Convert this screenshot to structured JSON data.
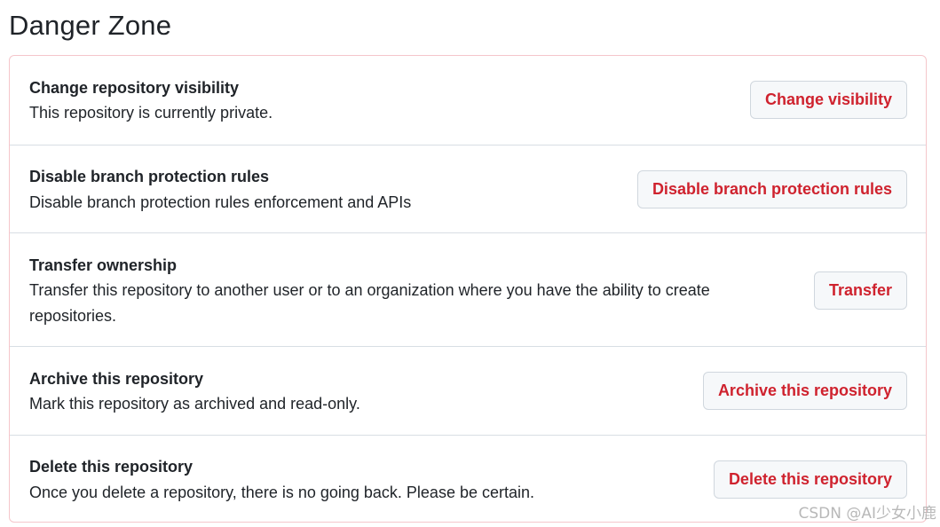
{
  "page": {
    "title": "Danger Zone"
  },
  "sections": [
    {
      "title": "Change repository visibility",
      "description": "This repository is currently private.",
      "button": "Change visibility"
    },
    {
      "title": "Disable branch protection rules",
      "description": "Disable branch protection rules enforcement and APIs",
      "button": "Disable branch protection rules"
    },
    {
      "title": "Transfer ownership",
      "description_line1": "Transfer this repository to another user or to an organization where you have the ability to create",
      "description_line2": "repositories.",
      "button": "Transfer"
    },
    {
      "title": "Archive this repository",
      "description": "Mark this repository as archived and read-only.",
      "button": "Archive this repository"
    },
    {
      "title": "Delete this repository",
      "description": "Once you delete a repository, there is no going back. Please be certain.",
      "button": "Delete this repository"
    }
  ],
  "watermark": "CSDN @AI少女小鹿",
  "colors": {
    "danger_text": "#cf222e",
    "danger_border": "#f5c6cb",
    "button_bg": "#f6f8fa",
    "divider": "#d8dee4",
    "text": "#1f2328"
  }
}
